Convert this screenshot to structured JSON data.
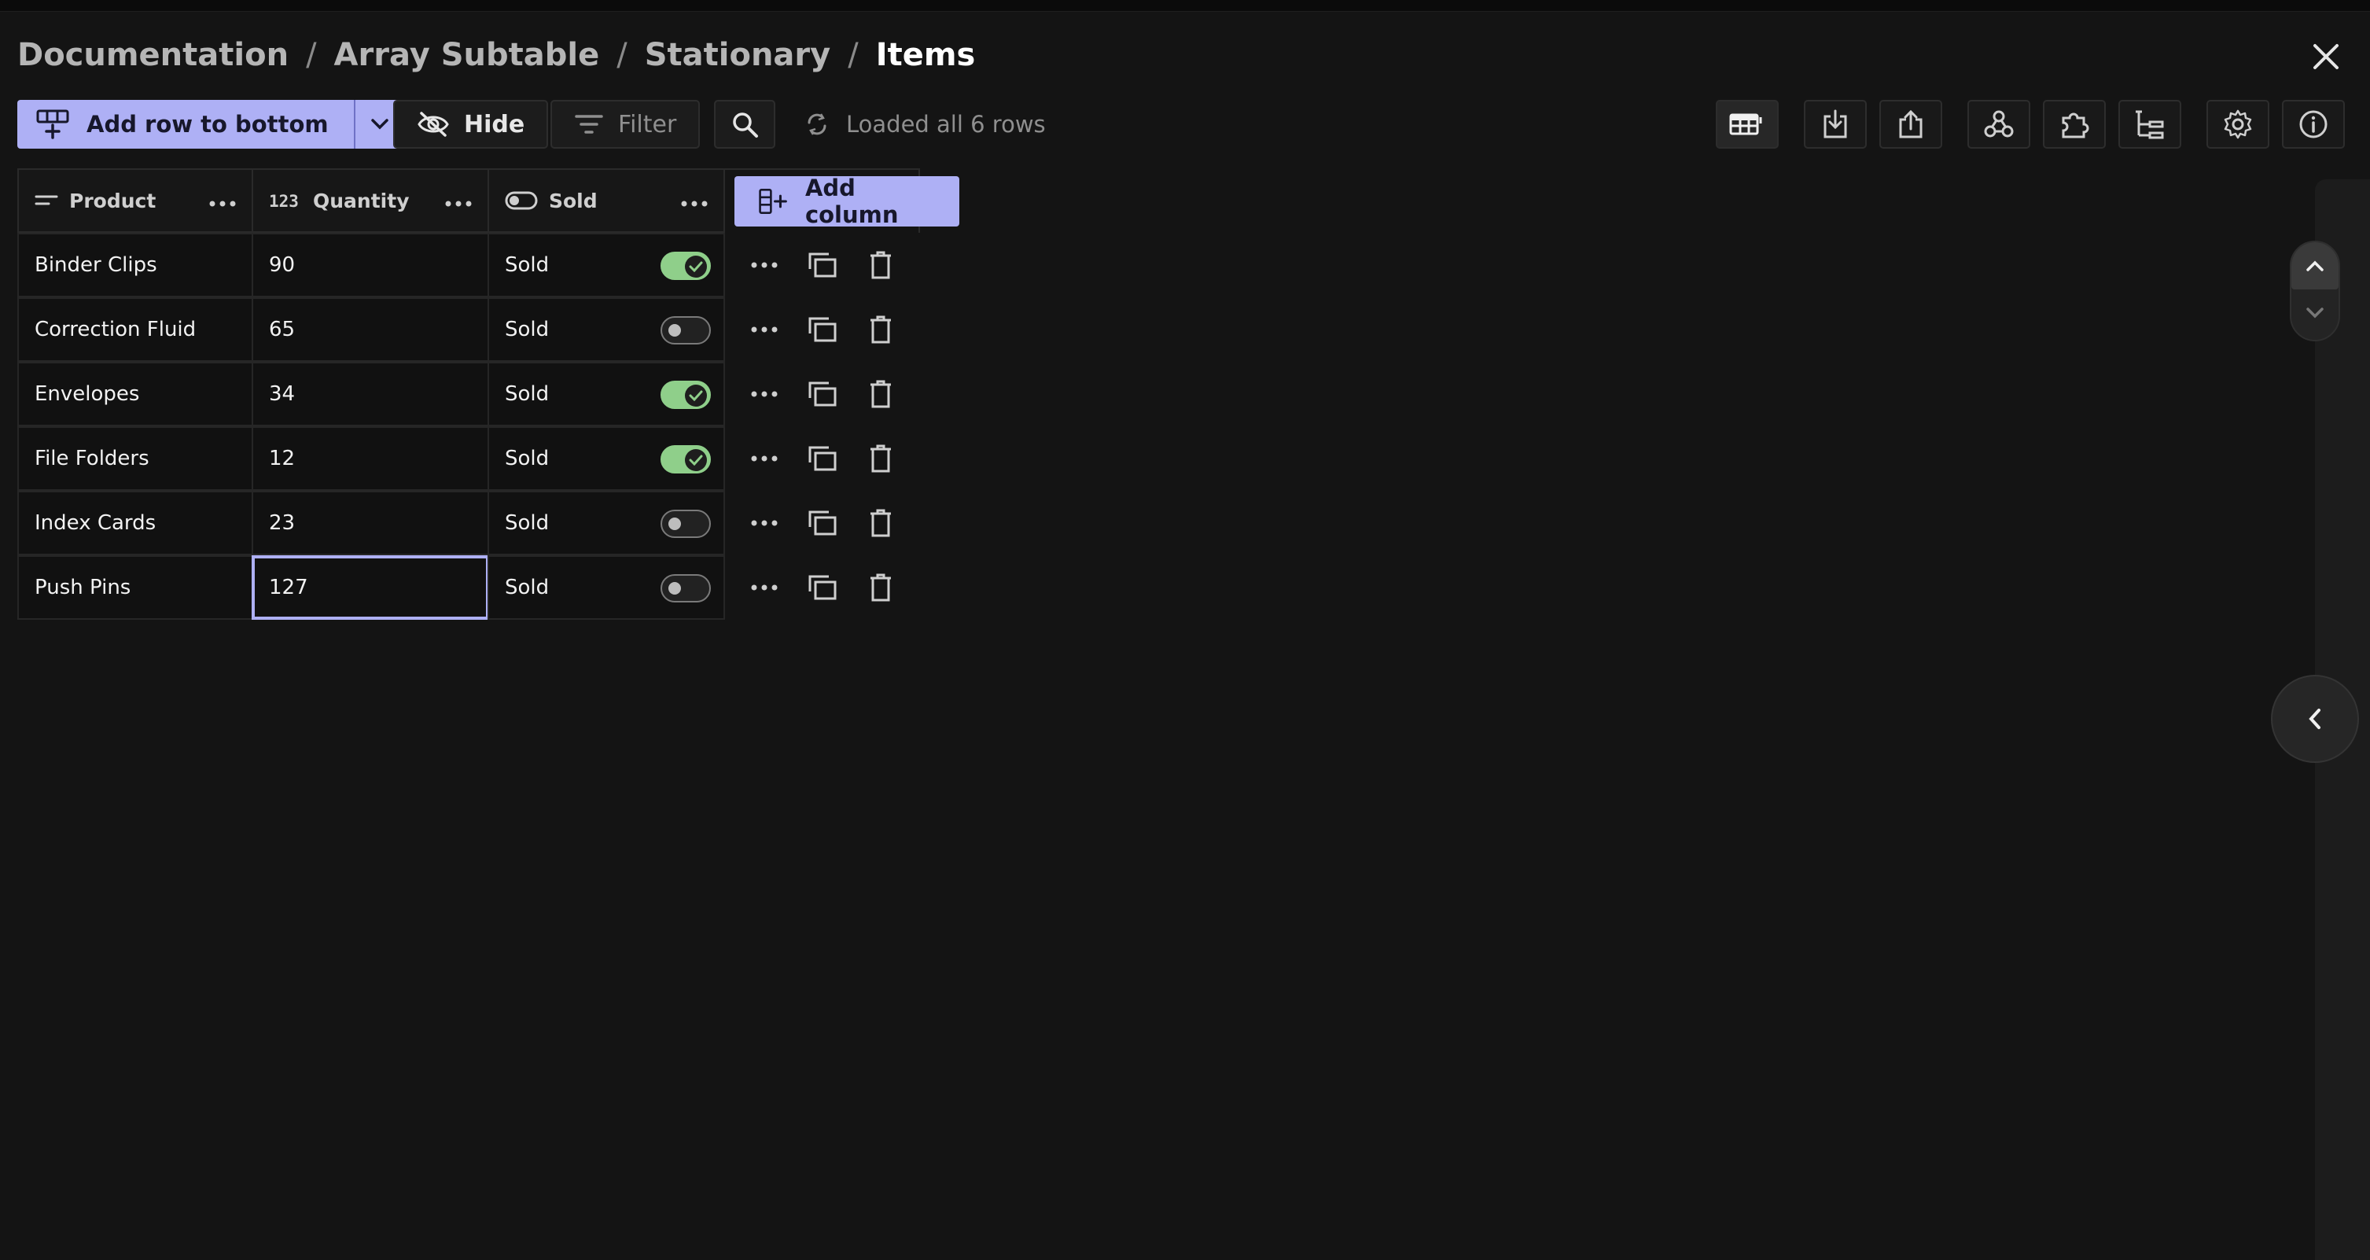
{
  "breadcrumb": [
    "Documentation",
    "Array Subtable",
    "Stationary",
    "Items"
  ],
  "toolbar": {
    "add_row_label": "Add row to bottom",
    "hide_label": "Hide",
    "filter_label": "Filter",
    "status_text": "Loaded all 6 rows"
  },
  "columns": [
    {
      "label": "Product",
      "icon": "text-icon"
    },
    {
      "label": "Quantity",
      "icon": "number-icon"
    },
    {
      "label": "Sold",
      "icon": "toggle-icon"
    }
  ],
  "add_column_label": "Add column",
  "rows": [
    {
      "product": "Binder Clips",
      "quantity": "90",
      "sold_label": "Sold",
      "sold": true
    },
    {
      "product": "Correction Fluid",
      "quantity": "65",
      "sold_label": "Sold",
      "sold": false
    },
    {
      "product": "Envelopes",
      "quantity": "34",
      "sold_label": "Sold",
      "sold": true
    },
    {
      "product": "File Folders",
      "quantity": "12",
      "sold_label": "Sold",
      "sold": true
    },
    {
      "product": "Index Cards",
      "quantity": "23",
      "sold_label": "Sold",
      "sold": false
    },
    {
      "product": "Push Pins",
      "quantity": "127",
      "sold_label": "Sold",
      "sold": false
    }
  ],
  "selected_cell": {
    "row": 5,
    "column": "quantity"
  },
  "colors": {
    "accent": "#aeb0f5",
    "toggle_on": "#8fcf8a",
    "background": "#141414"
  },
  "toolbar_icons": [
    "table-view-icon",
    "import-icon",
    "export-icon",
    "webhook-icon",
    "extension-icon",
    "tree-view-icon",
    "settings-icon",
    "info-icon"
  ]
}
